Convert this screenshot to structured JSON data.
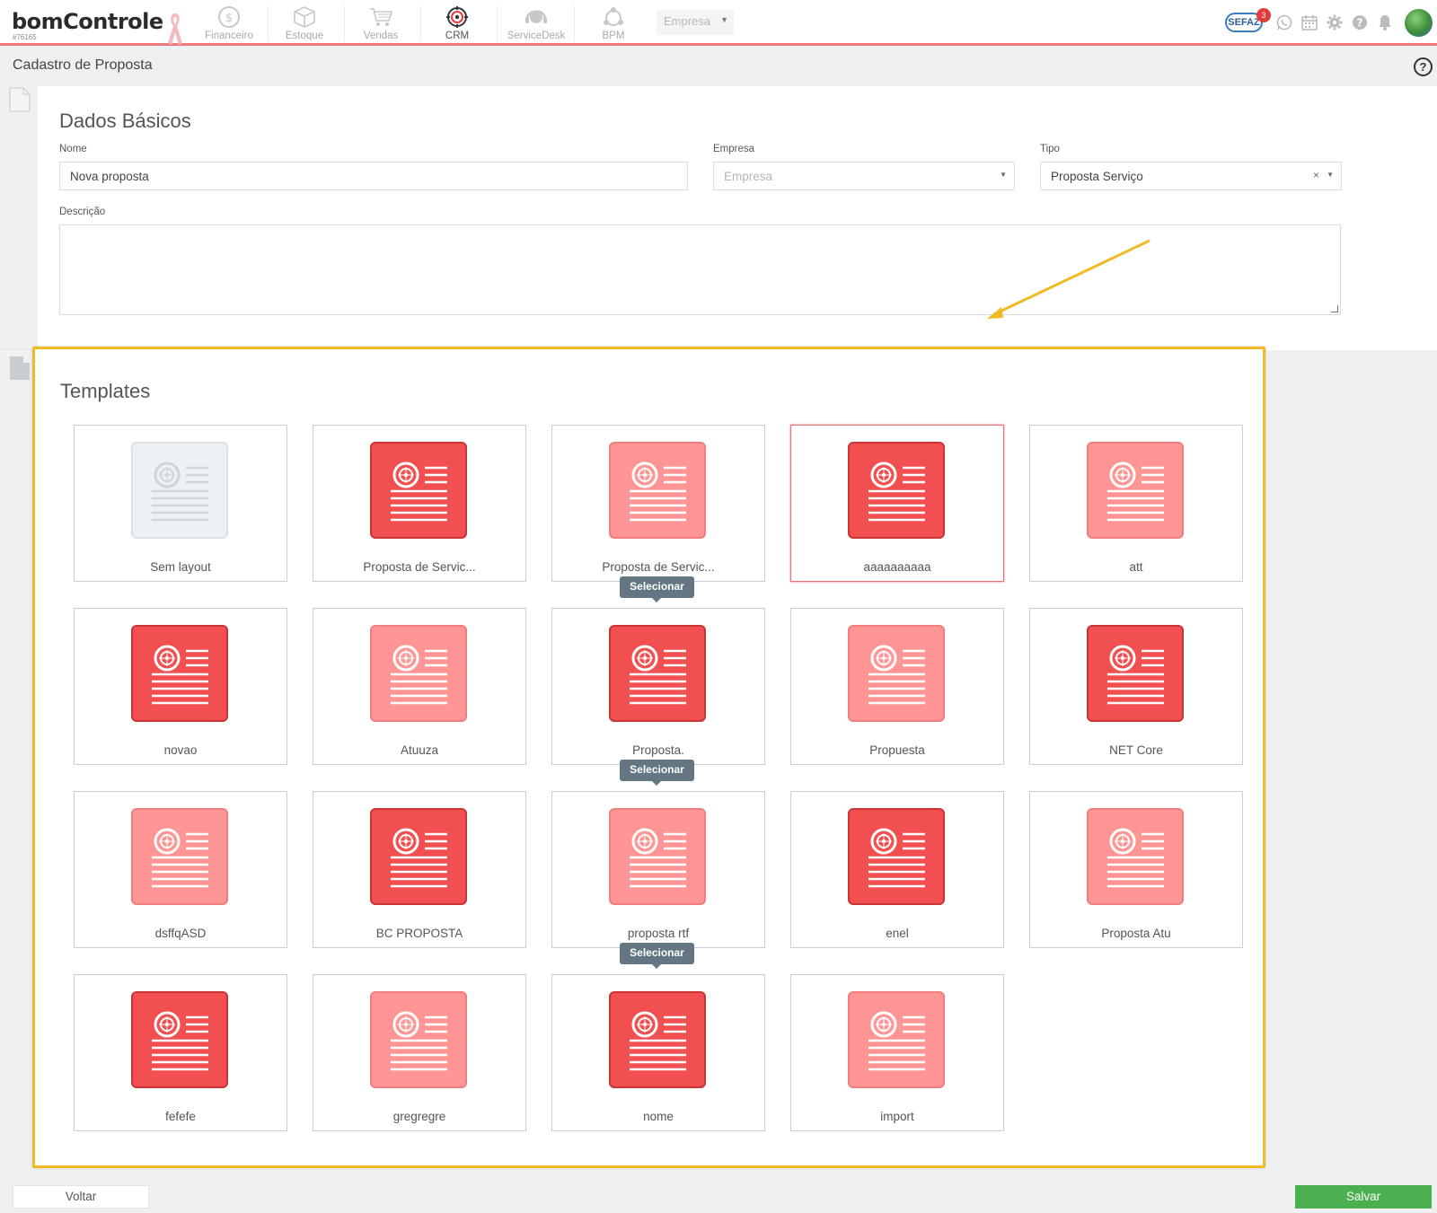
{
  "brand": {
    "logo": "bomControle",
    "account_id": "#76165"
  },
  "modules": [
    {
      "label": "Financeiro",
      "icon": "dollar-circle-icon"
    },
    {
      "label": "Estoque",
      "icon": "box-icon"
    },
    {
      "label": "Vendas",
      "icon": "cart-icon"
    },
    {
      "label": "CRM",
      "icon": "target-icon",
      "active": true
    },
    {
      "label": "ServiceDesk",
      "icon": "headset-icon"
    },
    {
      "label": "BPM",
      "icon": "flow-icon"
    }
  ],
  "company_select": {
    "value": "Empresa"
  },
  "header_icons": {
    "sefaz_label": "SEFAZ",
    "sefaz_count": "3"
  },
  "page": {
    "title": "Cadastro de Proposta",
    "help": "?"
  },
  "basic": {
    "title": "Dados Básicos",
    "name_label": "Nome",
    "name_value": "Nova proposta",
    "company_label": "Empresa",
    "company_placeholder": "Empresa",
    "type_label": "Tipo",
    "type_value": "Proposta Serviço",
    "description_label": "Descrição",
    "description_value": ""
  },
  "templates": {
    "title": "Templates",
    "tooltip": "Selecionar",
    "items": [
      {
        "name": "Sem layout",
        "style": "grey"
      },
      {
        "name": "Proposta de Servic...",
        "style": "red"
      },
      {
        "name": "Proposta de Servic...",
        "style": "pink"
      },
      {
        "name": "aaaaaaaaaa",
        "style": "red",
        "selected": true
      },
      {
        "name": "att",
        "style": "pink"
      },
      {
        "name": "novao",
        "style": "red"
      },
      {
        "name": "Atuuza",
        "style": "pink"
      },
      {
        "name": "Proposta.",
        "style": "red"
      },
      {
        "name": "Propuesta",
        "style": "pink"
      },
      {
        "name": "NET Core",
        "style": "red"
      },
      {
        "name": "dsffqASD",
        "style": "pink"
      },
      {
        "name": "BC PROPOSTA",
        "style": "red"
      },
      {
        "name": "proposta rtf",
        "style": "pink"
      },
      {
        "name": "enel",
        "style": "red"
      },
      {
        "name": "Proposta Atu",
        "style": "pink"
      },
      {
        "name": "fefefe",
        "style": "red"
      },
      {
        "name": "gregregre",
        "style": "pink"
      },
      {
        "name": "nome",
        "style": "red"
      },
      {
        "name": "import",
        "style": "pink"
      }
    ]
  },
  "footer": {
    "back_label": "Voltar",
    "save_label": "Salvar"
  },
  "colors": {
    "accent": "#f2797b",
    "highlight": "#efba22",
    "save": "#4caf50",
    "tile_red": "#f24f50",
    "tile_pink": "#ff9595"
  }
}
